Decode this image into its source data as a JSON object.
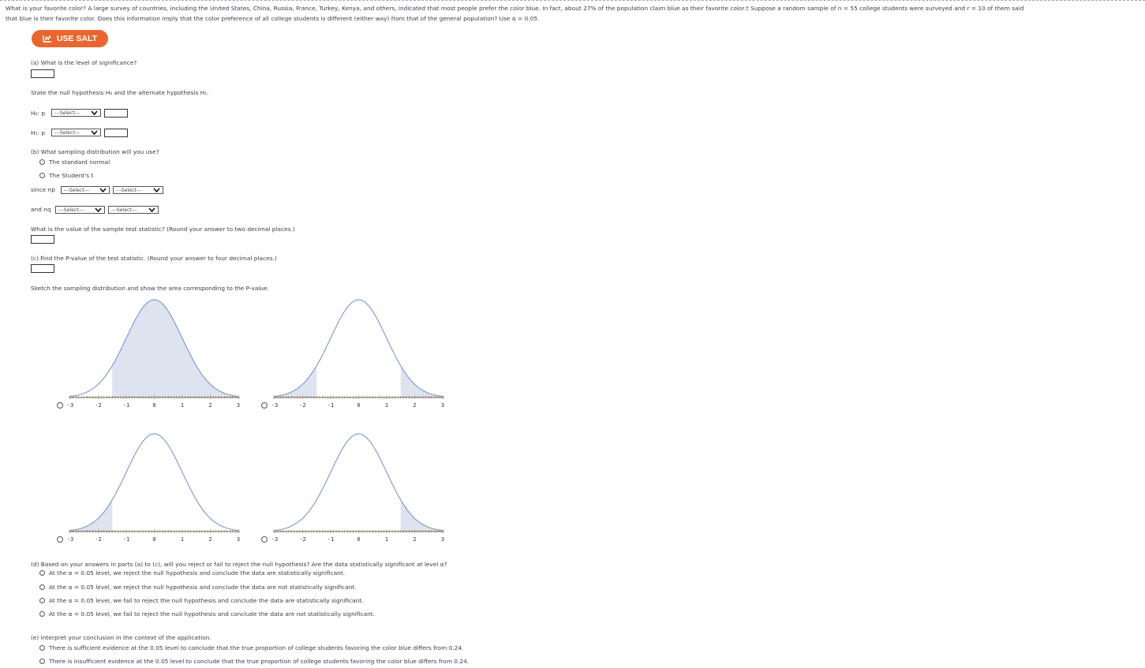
{
  "question": {
    "intro_line1": "What is your favorite color? A large survey of countries, including the United States, China, Russia, France, Turkey, Kenya, and others, indicated that most people prefer the color blue. In fact, about 27% of the population claim blue as their favorite color.† Suppose a random sample of n = 55 college students were surveyed and r = 10 of them said",
    "intro_line2": "that blue is their favorite color. Does this information imply that the color preference of all college students is different (either way) from that of the general population? Use α = 0.05."
  },
  "salt": {
    "label": "USE SALT",
    "icon": "salt-icon"
  },
  "part_a": {
    "question": "(a) What is the level of significance?",
    "hypotheses_prompt": "State the null hypothesis H₀ and the alternate hypothesis H₁.",
    "h0_label": "H₀: p",
    "h1_label": "H₁: p",
    "select_placeholder": "---Select---"
  },
  "part_b": {
    "question": "(b) What sampling distribution will you use?",
    "options": [
      "The standard normal",
      "The Student's t"
    ],
    "since_np_label": "since np",
    "and_nq_label": "and nq",
    "select_placeholder": "---Select---",
    "test_stat_prompt": "What is the value of the sample test statistic? (Round your answer to two decimal places.)"
  },
  "part_c": {
    "question": "(c) Find the P-value of the test statistic. (Round your answer to four decimal places.)",
    "sketch_prompt": "Sketch the sampling distribution and show the area corresponding to the P-value."
  },
  "graphs": {
    "tick_labels": [
      "-3",
      "-2",
      "-1",
      "0",
      "1",
      "2",
      "3"
    ],
    "options": [
      {
        "id": "graph-option-1",
        "shading": "between",
        "from": -1.5,
        "to": 3
      },
      {
        "id": "graph-option-2",
        "shading": "two-tailed",
        "left": -1.5,
        "right": 1.5
      },
      {
        "id": "graph-option-3",
        "shading": "left-tail",
        "left": -1.5
      },
      {
        "id": "graph-option-4",
        "shading": "right-tail",
        "right": 1.5
      }
    ],
    "curve_color": "#6f8ec9",
    "fill_color": "#dde4ef",
    "axis_color": "#7a6a55"
  },
  "part_d": {
    "question": "(d) Based on your answers in parts (a) to (c), will you reject or fail to reject the null hypothesis? Are the data statistically significant at level α?",
    "options": [
      "At the α = 0.05 level, we reject the null hypothesis and conclude the data are statistically significant.",
      "At the α = 0.05 level, we reject the null hypothesis and conclude the data are not statistically significant.",
      "At the α = 0.05 level, we fail to reject the null hypothesis and conclude the data are statistically significant.",
      "At the α = 0.05 level, we fail to reject the null hypothesis and conclude the data are not statistically significant."
    ]
  },
  "part_e": {
    "question": "(e) Interpret your conclusion in the context of the application.",
    "options": [
      "There is sufficient evidence at the 0.05 level to conclude that the true proportion of college students favoring the color blue differs from 0.24.",
      "There is insufficient evidence at the 0.05 level to conclude that the true proportion of college students favoring the color blue differs from 0.24."
    ]
  },
  "colors": {
    "salt_button": "#e8672f",
    "text": "#3a3a4a"
  }
}
